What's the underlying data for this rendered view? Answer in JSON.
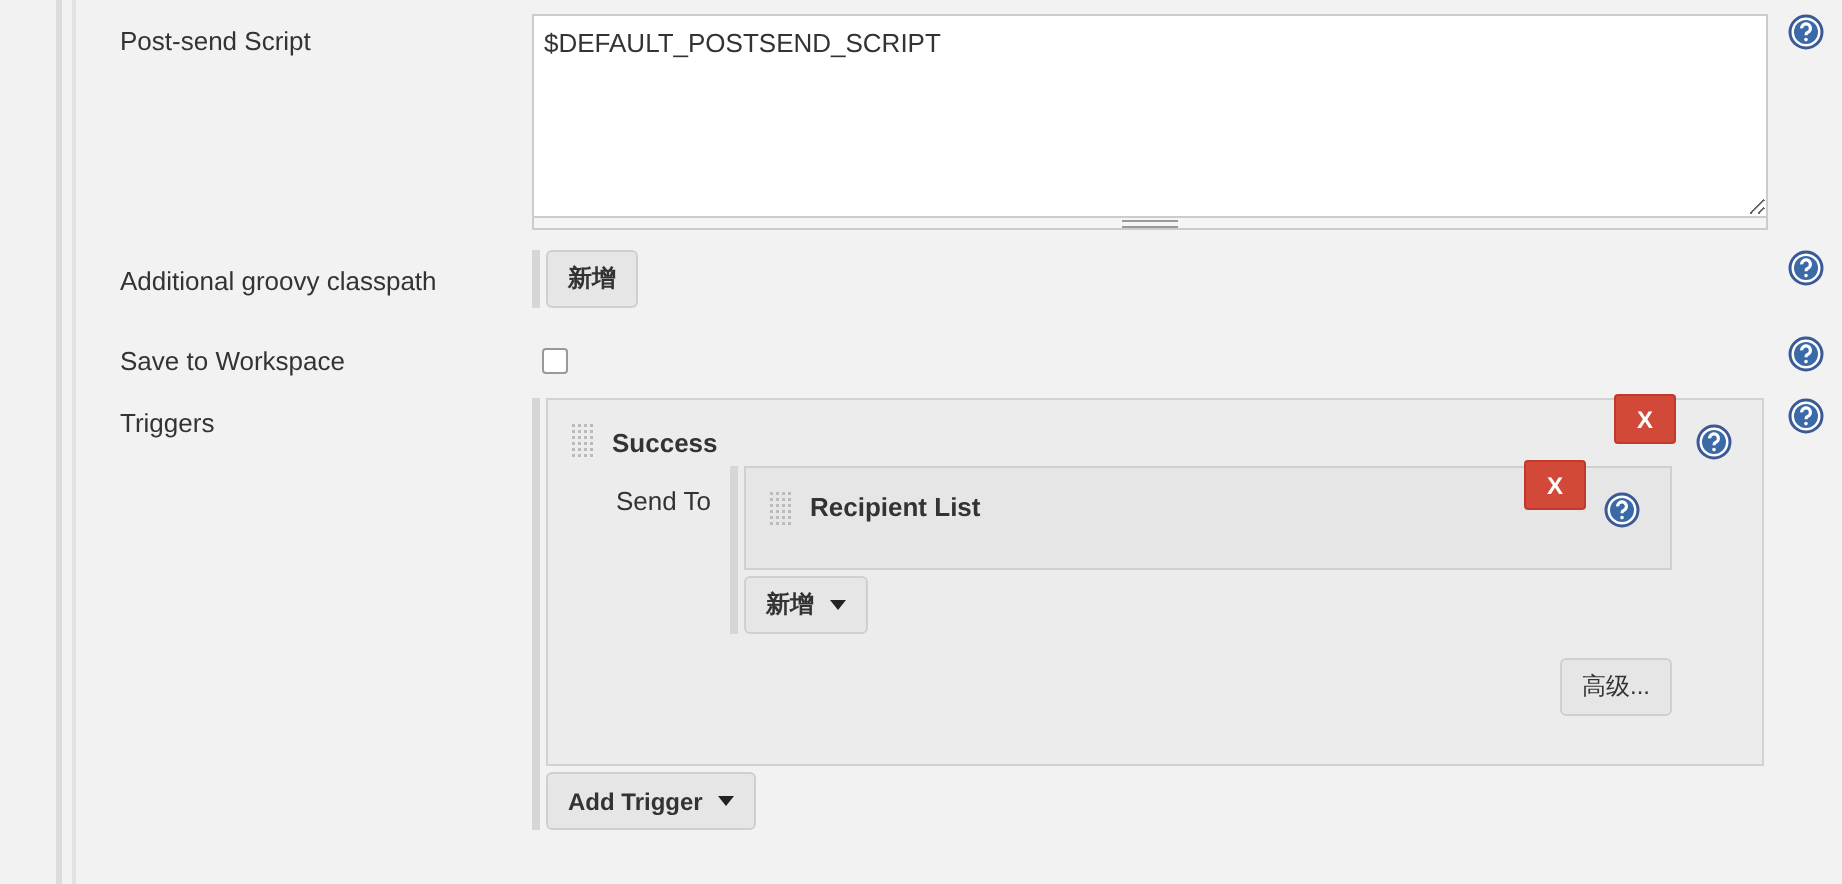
{
  "fields": [
    {
      "kind": "textarea",
      "label": "Post-send Script",
      "value": "$DEFAULT_POSTSEND_SCRIPT"
    },
    {
      "kind": "button",
      "label": "Additional groovy classpath",
      "button": "新增"
    },
    {
      "kind": "checkbox",
      "label": "Save to Workspace",
      "checked": false
    },
    {
      "kind": "triggers",
      "label": "Triggers"
    }
  ],
  "triggers": {
    "items": [
      {
        "name": "Success",
        "delete": "X",
        "send_to_label": "Send To",
        "recipients": [
          {
            "name": "Recipient List",
            "delete": "X"
          }
        ],
        "add_button": "新增",
        "advanced_button": "高级..."
      }
    ],
    "add_button": "Add Trigger"
  }
}
